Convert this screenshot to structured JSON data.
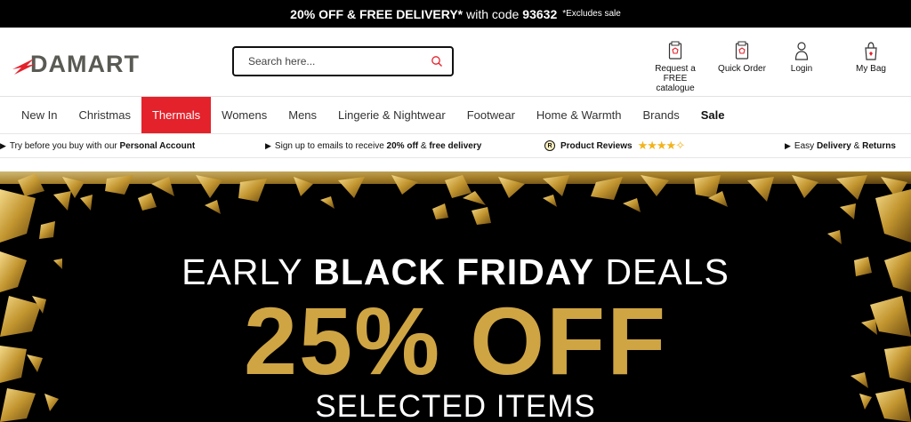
{
  "promo": {
    "main": "20% OFF & FREE DELIVERY*",
    "code_prefix": "with code",
    "code": "93632",
    "excludes": "*Excludes sale"
  },
  "brand": {
    "logo_text": "DAMART",
    "accent": "#e3222b"
  },
  "search": {
    "placeholder": "Search here..."
  },
  "header_links": {
    "catalogue": "Request a FREE catalogue",
    "quick_order": "Quick Order",
    "login": "Login",
    "bag": "My Bag"
  },
  "nav": {
    "items": [
      "New In",
      "Christmas",
      "Thermals",
      "Womens",
      "Mens",
      "Lingerie & Nightwear",
      "Footwear",
      "Home & Warmth",
      "Brands",
      "Sale"
    ],
    "active": "Thermals"
  },
  "usp": {
    "try_pre": "Try before you buy with our",
    "try_bold": "Personal Account",
    "email_pre": "Sign up to emails to receive",
    "email_bold1": "20% off",
    "email_mid": "&",
    "email_bold2": "free delivery",
    "reviews_badge": "R",
    "reviews_label": "Product Reviews",
    "rating_stars": 4.5,
    "delivery_pre": "Easy",
    "delivery_bold1": "Delivery",
    "delivery_mid": "&",
    "delivery_bold2": "Returns"
  },
  "hero": {
    "line1_thin_a": "EARLY",
    "line1_bold": "BLACK FRIDAY",
    "line1_thin_b": "DEALS",
    "line2": "25% OFF",
    "line3": "SELECTED ITEMS",
    "gold": "#cfa544"
  }
}
